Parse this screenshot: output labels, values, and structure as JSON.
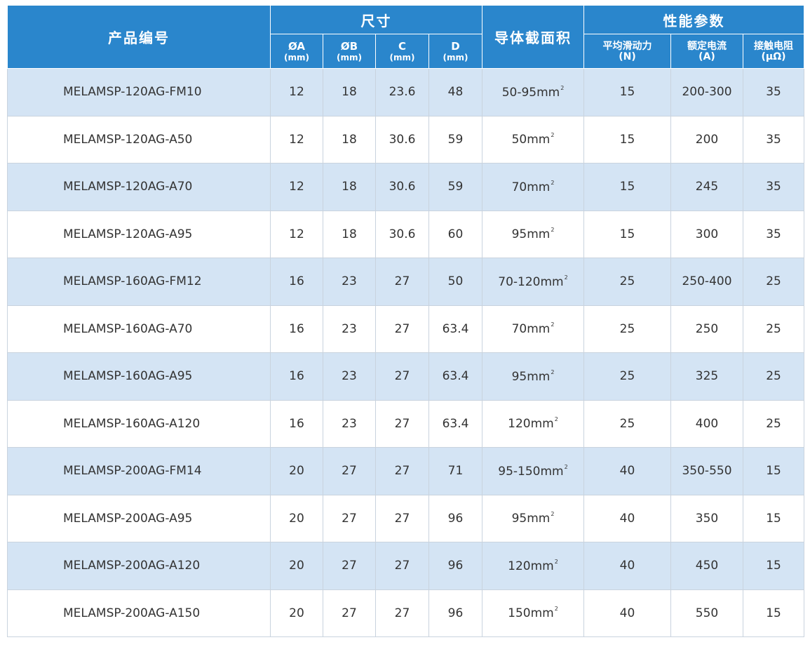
{
  "header": {
    "product_no": "产品编号",
    "dimensions": "尺寸",
    "cross_section": "导体截面积",
    "performance": "性能参数",
    "dim_cols": [
      {
        "label": "ØA",
        "unit": "(mm)"
      },
      {
        "label": "ØB",
        "unit": "(mm)"
      },
      {
        "label": "C",
        "unit": "(mm)"
      },
      {
        "label": "D",
        "unit": "(mm)"
      }
    ],
    "perf_cols": [
      {
        "label": "平均滑动力",
        "unit": "(N)"
      },
      {
        "label": "额定电流",
        "unit": "(A)"
      },
      {
        "label": "接触电阻",
        "unit": "(μΩ)"
      }
    ]
  },
  "rows": [
    {
      "model": "MELAMSP-120AG-FM10",
      "a": "12",
      "b": "18",
      "c": "23.6",
      "d": "48",
      "area": "50-95mm",
      "sup": "2",
      "force": "15",
      "current": "200-300",
      "resistance": "35"
    },
    {
      "model": "MELAMSP-120AG-A50",
      "a": "12",
      "b": "18",
      "c": "30.6",
      "d": "59",
      "area": "50mm",
      "sup": "2",
      "force": "15",
      "current": "200",
      "resistance": "35"
    },
    {
      "model": "MELAMSP-120AG-A70",
      "a": "12",
      "b": "18",
      "c": "30.6",
      "d": "59",
      "area": "70mm",
      "sup": "2",
      "force": "15",
      "current": "245",
      "resistance": "35"
    },
    {
      "model": "MELAMSP-120AG-A95",
      "a": "12",
      "b": "18",
      "c": "30.6",
      "d": "60",
      "area": "95mm",
      "sup": "2",
      "force": "15",
      "current": "300",
      "resistance": "35"
    },
    {
      "model": "MELAMSP-160AG-FM12",
      "a": "16",
      "b": "23",
      "c": "27",
      "d": "50",
      "area": "70-120mm",
      "sup": "2",
      "force": "25",
      "current": "250-400",
      "resistance": "25"
    },
    {
      "model": "MELAMSP-160AG-A70",
      "a": "16",
      "b": "23",
      "c": "27",
      "d": "63.4",
      "area": "70mm",
      "sup": "2",
      "force": "25",
      "current": "250",
      "resistance": "25"
    },
    {
      "model": "MELAMSP-160AG-A95",
      "a": "16",
      "b": "23",
      "c": "27",
      "d": "63.4",
      "area": "95mm",
      "sup": "2",
      "force": "25",
      "current": "325",
      "resistance": "25"
    },
    {
      "model": "MELAMSP-160AG-A120",
      "a": "16",
      "b": "23",
      "c": "27",
      "d": "63.4",
      "area": "120mm",
      "sup": "2",
      "force": "25",
      "current": "400",
      "resistance": "25"
    },
    {
      "model": "MELAMSP-200AG-FM14",
      "a": "20",
      "b": "27",
      "c": "27",
      "d": "71",
      "area": "95-150mm",
      "sup": "2",
      "force": "40",
      "current": "350-550",
      "resistance": "15"
    },
    {
      "model": "MELAMSP-200AG-A95",
      "a": "20",
      "b": "27",
      "c": "27",
      "d": "96",
      "area": "95mm",
      "sup": "2",
      "force": "40",
      "current": "350",
      "resistance": "15"
    },
    {
      "model": "MELAMSP-200AG-A120",
      "a": "20",
      "b": "27",
      "c": "27",
      "d": "96",
      "area": "120mm",
      "sup": "2",
      "force": "40",
      "current": "450",
      "resistance": "15"
    },
    {
      "model": "MELAMSP-200AG-A150",
      "a": "20",
      "b": "27",
      "c": "27",
      "d": "96",
      "area": "150mm",
      "sup": "2",
      "force": "40",
      "current": "550",
      "resistance": "15"
    }
  ],
  "colors": {
    "header_bg": "#2a86cc",
    "row_alt_bg": "#d4e4f4",
    "row_bg": "#ffffff",
    "text": "#333333"
  }
}
